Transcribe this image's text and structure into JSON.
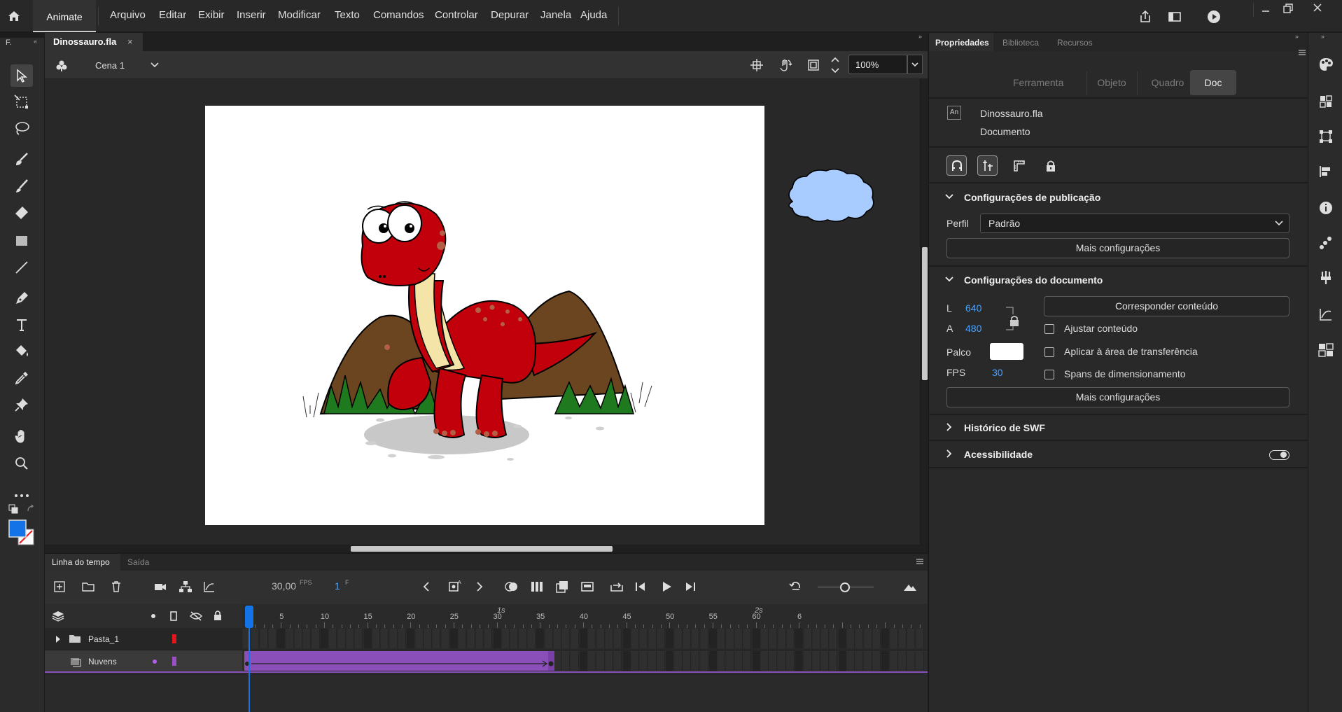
{
  "menubar": {
    "app_tab": "Animate",
    "items": [
      "Arquivo",
      "Editar",
      "Exibir",
      "Inserir",
      "Modificar",
      "Texto",
      "Comandos",
      "Controlar",
      "Depurar",
      "Janela",
      "Ajuda"
    ]
  },
  "document": {
    "tab_label": "Dinossauro.fla",
    "scene_label": "Cena 1",
    "zoom": "100%"
  },
  "toolbar": {
    "panel_short": "F."
  },
  "timeline": {
    "tabs": [
      "Linha do tempo",
      "Saída"
    ],
    "fps_value": "30,00",
    "fps_unit": "FPS",
    "frame_value": "1",
    "frame_unit": "F",
    "ruler_ticks": [
      "5",
      "10",
      "15",
      "20",
      "25",
      "30",
      "35",
      "40",
      "45",
      "50",
      "55",
      "60",
      "6"
    ],
    "ruler_seconds": [
      "1s",
      "2s"
    ],
    "layers": [
      {
        "name": "Pasta_1",
        "color": "#e5161b"
      },
      {
        "name": "Nuvens",
        "color": "#9b4fc7"
      }
    ]
  },
  "properties": {
    "tabs": [
      "Propriedades",
      "Biblioteca",
      "Recursos"
    ],
    "subtabs": [
      "Ferramenta",
      "Objeto",
      "Quadro",
      "Doc"
    ],
    "doc_icon": "An",
    "doc_name": "Dinossauro.fla",
    "doc_type": "Documento",
    "publish": {
      "title": "Configurações de publicação",
      "profile_label": "Perfil",
      "profile_value": "Padrão",
      "more_button": "Mais configurações"
    },
    "docsettings": {
      "title": "Configurações do documento",
      "width_label": "L",
      "width_value": "640",
      "height_label": "A",
      "height_value": "480",
      "stage_label": "Palco",
      "fps_label": "FPS",
      "fps_value": "30",
      "match_button": "Corresponder conteúdo",
      "check_adjust": "Ajustar conteúdo",
      "check_clipboard": "Aplicar à área de transferência",
      "check_spans": "Spans de dimensionamento",
      "more_button": "Mais configurações"
    },
    "swf_history": "Histórico de SWF",
    "accessibility": "Acessibilidade"
  },
  "colors": {
    "accent": "#1473e6",
    "layer_purple": "#8a4fb8",
    "stage": "#ffffff"
  }
}
